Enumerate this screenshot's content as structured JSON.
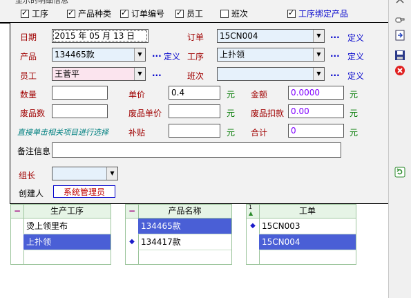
{
  "top_bar": {
    "cut_label": "显示的明细信息",
    "checkboxes": [
      {
        "label": "工序",
        "checked": true
      },
      {
        "label": "产品种类",
        "checked": true
      },
      {
        "label": "订单编号",
        "checked": true
      },
      {
        "label": "员工",
        "checked": true
      },
      {
        "label": "班次",
        "checked": false
      },
      {
        "label": "工序绑定产品",
        "checked": true
      }
    ]
  },
  "form": {
    "date": {
      "label": "日期",
      "value": "2015 年 05 月 13 日"
    },
    "order": {
      "label": "订单",
      "value": "15CN004",
      "dots": "...",
      "define": "定义"
    },
    "product": {
      "label": "产品",
      "value": "134465款",
      "dots": "...",
      "define": "定义"
    },
    "process": {
      "label": "工序",
      "value": "上扑领",
      "dots": "...",
      "define": "定义"
    },
    "employee": {
      "label": "员工",
      "value": "王菅平",
      "dots": "..."
    },
    "shift": {
      "label": "班次",
      "value": "",
      "dots": "...",
      "define": "定义"
    },
    "quantity": {
      "label": "数量",
      "value": ""
    },
    "unit_price": {
      "label": "单价",
      "value": "0.4",
      "unit": "元"
    },
    "amount": {
      "label": "金额",
      "value": "0.0000",
      "unit": "元"
    },
    "defect_count": {
      "label": "废品数",
      "value": ""
    },
    "defect_price": {
      "label": "废品单价",
      "value": "",
      "unit": "元"
    },
    "defect_deduct": {
      "label": "废品扣款",
      "value": "0.00",
      "unit": "元"
    },
    "hint": "直接单击相关项目进行选择",
    "subsidy": {
      "label": "补贴",
      "value": "",
      "unit": "元"
    },
    "total": {
      "label": "合计",
      "value": "0",
      "unit": "元"
    },
    "remark": {
      "label": "备注信息",
      "value": ""
    },
    "group_leader": {
      "label": "组长",
      "value": ""
    },
    "creator": {
      "label": "创建人",
      "value": "系统管理员"
    }
  },
  "grids": {
    "process": {
      "minus": "−",
      "title": "生产工序",
      "rows": [
        {
          "text": "烫上领里布",
          "selected": false
        },
        {
          "text": "上扑领",
          "selected": true
        }
      ]
    },
    "product": {
      "minus": "−",
      "title": "产品名称",
      "rows": [
        {
          "text": "134465款",
          "selected": true,
          "marker": false
        },
        {
          "text": "134417款",
          "selected": false,
          "marker": true
        }
      ]
    },
    "order": {
      "sort_num": "1",
      "sort_tri": "▲",
      "title": "工单",
      "rows": [
        {
          "text": "15CN003",
          "selected": false,
          "marker": true
        },
        {
          "text": "15CN004",
          "selected": true,
          "marker": false
        }
      ]
    }
  },
  "toolbar_icons": [
    "attach-icon",
    "hand-pointer-icon",
    "import-icon",
    "save-icon",
    "delete-icon",
    "refresh-icon"
  ],
  "colors": {
    "label_red": "#a00000",
    "link_blue": "#0000cc",
    "unit_green": "#007a00",
    "selection": "#4a5fd6",
    "grid_header": "#e6f4e6"
  }
}
